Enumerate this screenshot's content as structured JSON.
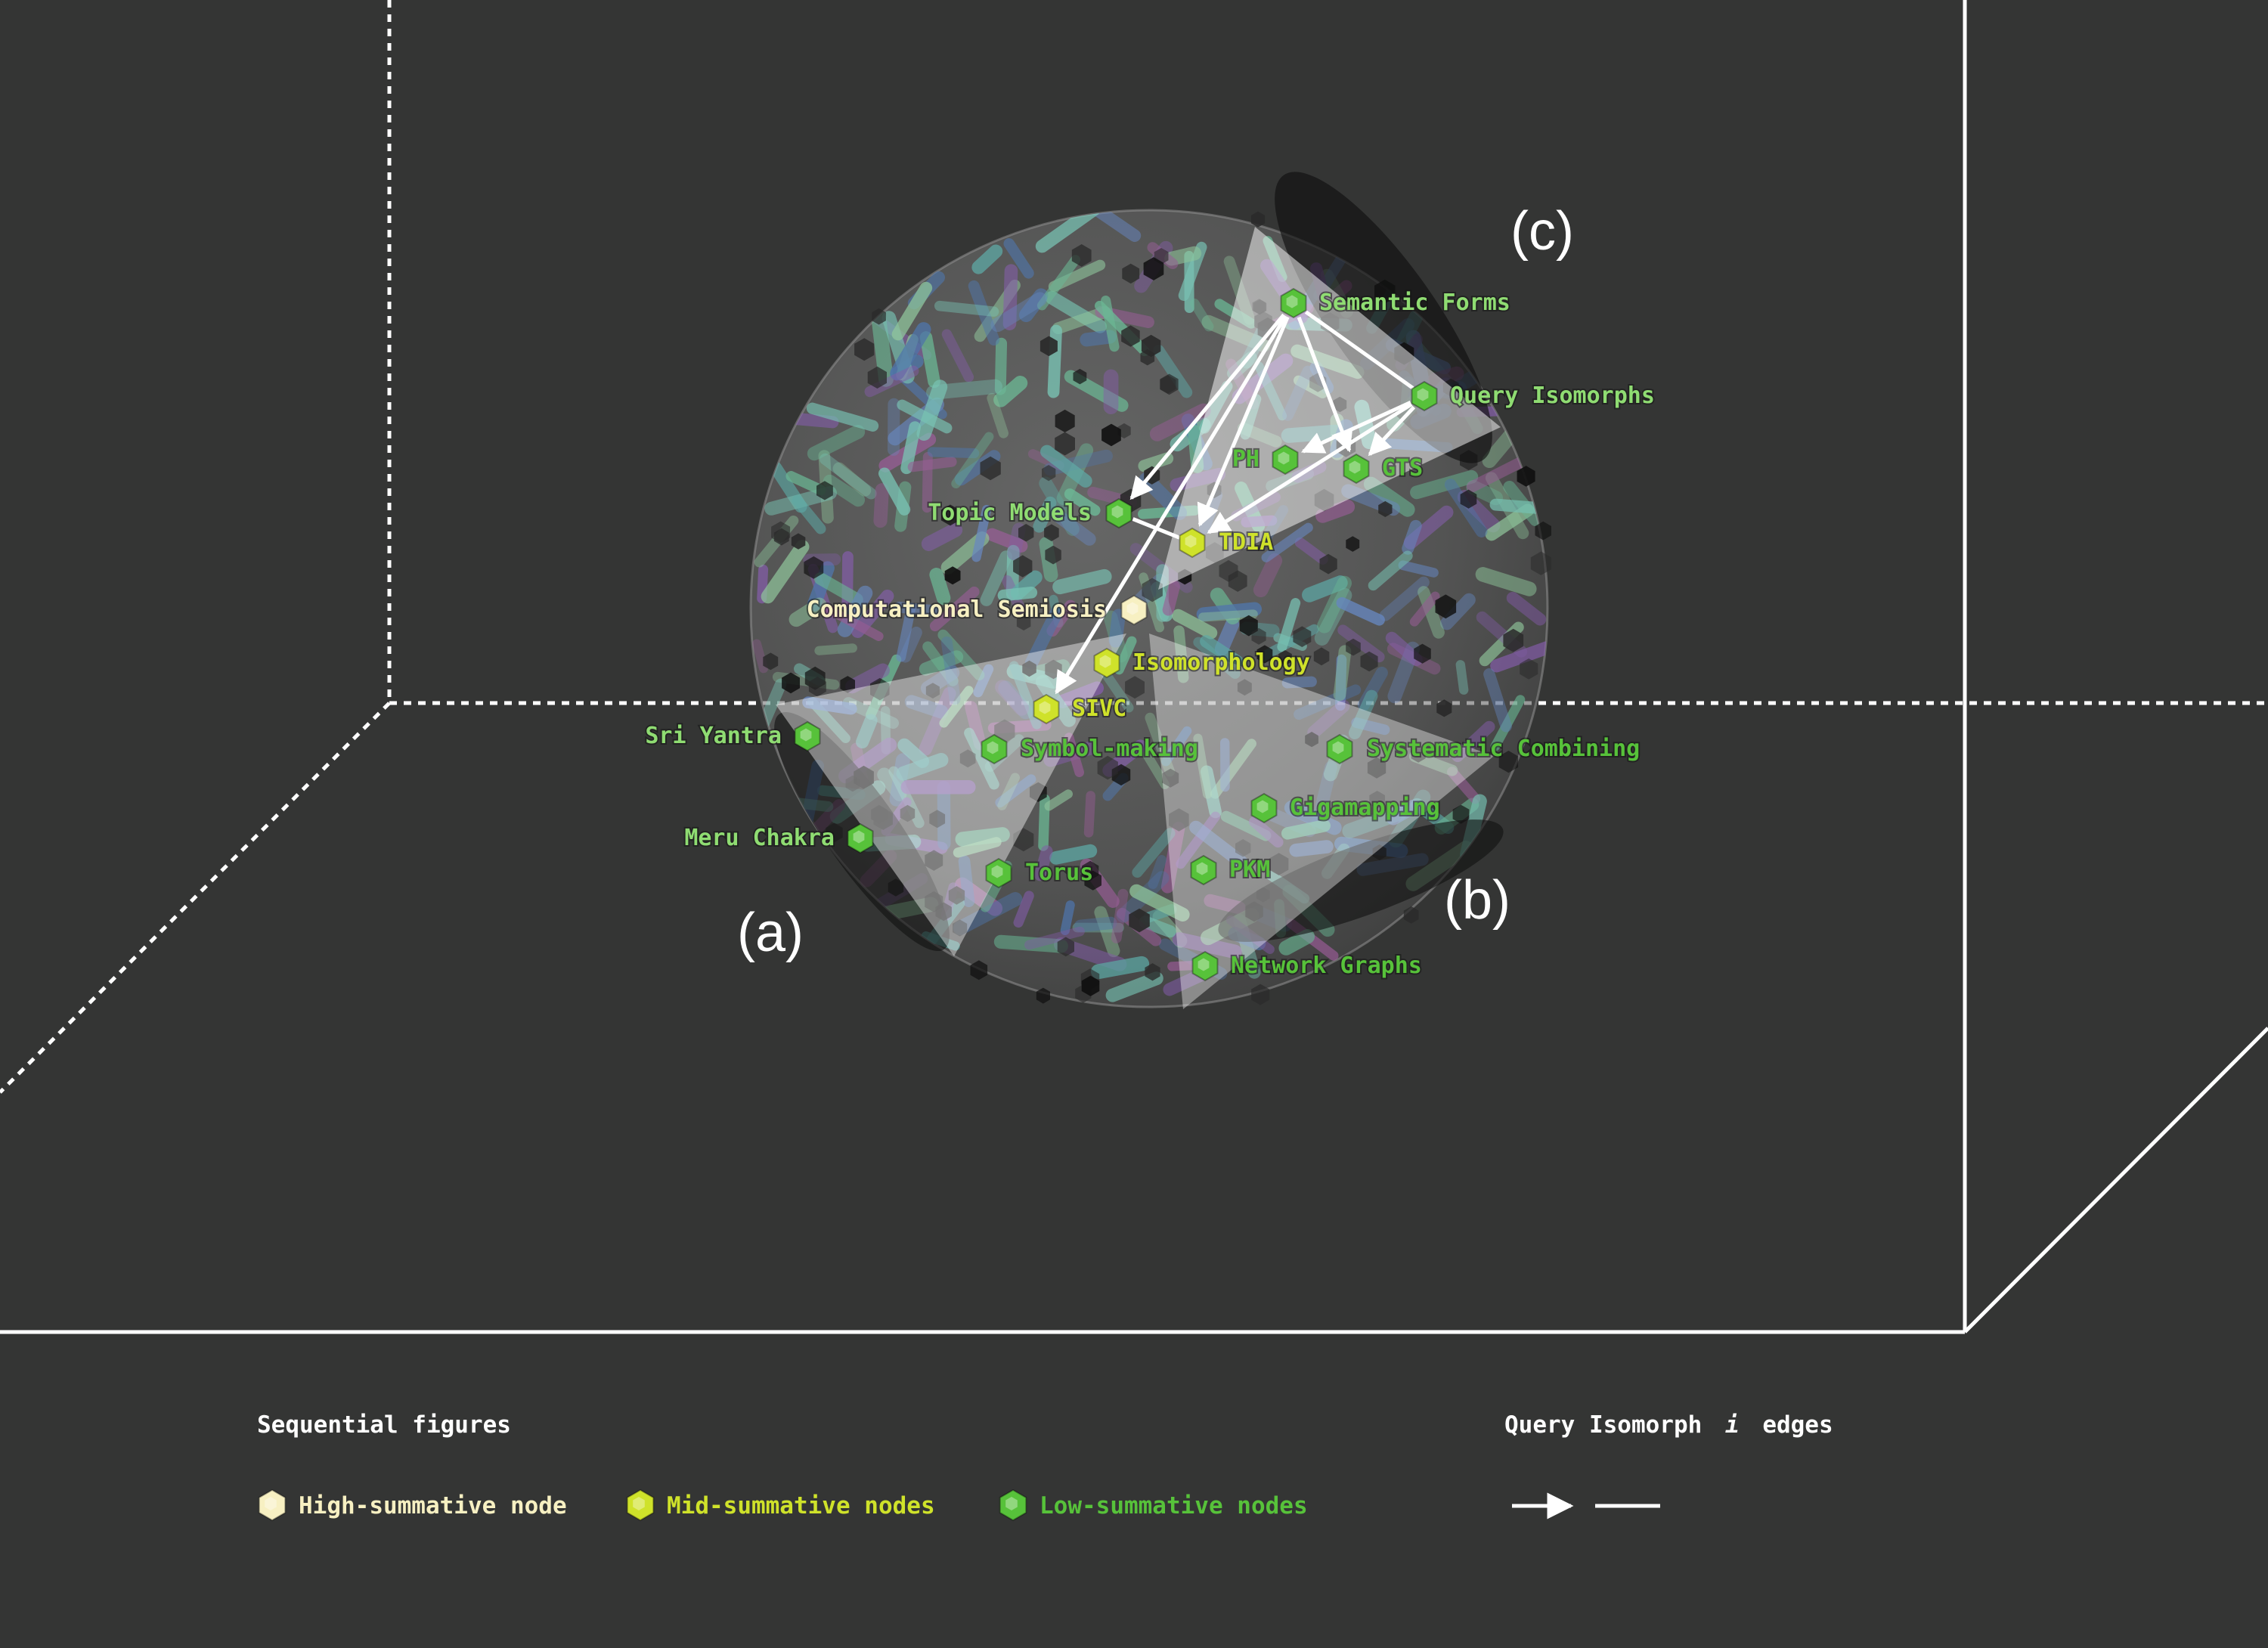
{
  "colors": {
    "background": "#343534",
    "high": "#f7f0c2",
    "mid": "#cfe22a",
    "low": "#57c23a",
    "low_light": "#8fdc72",
    "frame": "#ffffff"
  },
  "panels": {
    "a": "(a)",
    "b": "(b)",
    "c": "(c)"
  },
  "nodes": [
    {
      "id": "semantic-forms",
      "label": "Semantic Forms",
      "level": "low"
    },
    {
      "id": "query-isomorphs",
      "label": "Query Isomorphs",
      "level": "low"
    },
    {
      "id": "ph",
      "label": "PH",
      "level": "low"
    },
    {
      "id": "gts",
      "label": "GTS",
      "level": "low"
    },
    {
      "id": "topic-models",
      "label": "Topic Models",
      "level": "low"
    },
    {
      "id": "tdia",
      "label": "TDIA",
      "level": "mid"
    },
    {
      "id": "computational-semiosis",
      "label": "Computational Semiosis",
      "level": "high"
    },
    {
      "id": "isomorphology",
      "label": "Isomorphology",
      "level": "mid"
    },
    {
      "id": "sivc",
      "label": "SIVC",
      "level": "mid"
    },
    {
      "id": "sri-yantra",
      "label": "Sri Yantra",
      "level": "low"
    },
    {
      "id": "symbol-making",
      "label": "Symbol-making",
      "level": "low"
    },
    {
      "id": "systematic-combining",
      "label": "Systematic Combining",
      "level": "low"
    },
    {
      "id": "gigamapping",
      "label": "Gigamapping",
      "level": "low"
    },
    {
      "id": "meru-chakra",
      "label": "Meru Chakra",
      "level": "low"
    },
    {
      "id": "torus",
      "label": "Torus",
      "level": "low"
    },
    {
      "id": "pkm",
      "label": "PKM",
      "level": "low"
    },
    {
      "id": "network-graphs",
      "label": "Network Graphs",
      "level": "low"
    }
  ],
  "edges": [
    {
      "from": "semantic-forms",
      "to": "topic-models",
      "type": "arrow"
    },
    {
      "from": "semantic-forms",
      "to": "tdia",
      "type": "arrow"
    },
    {
      "from": "semantic-forms",
      "to": "sivc",
      "type": "arrow"
    },
    {
      "from": "semantic-forms",
      "to": "gts",
      "type": "arrow"
    },
    {
      "from": "semantic-forms",
      "to": "query-isomorphs",
      "type": "line"
    },
    {
      "from": "query-isomorphs",
      "to": "ph",
      "type": "arrow"
    },
    {
      "from": "query-isomorphs",
      "to": "gts",
      "type": "arrow"
    },
    {
      "from": "query-isomorphs",
      "to": "tdia",
      "type": "arrow"
    },
    {
      "from": "topic-models",
      "to": "tdia",
      "type": "line"
    }
  ],
  "legend": {
    "sequential_title": "Sequential figures",
    "high_label": "High-summative node",
    "mid_label": "Mid-summative nodes",
    "low_label": "Low-summative nodes",
    "edges_title_prefix": "Query Isomorph",
    "edges_title_italic": "i",
    "edges_title_suffix": "edges"
  }
}
